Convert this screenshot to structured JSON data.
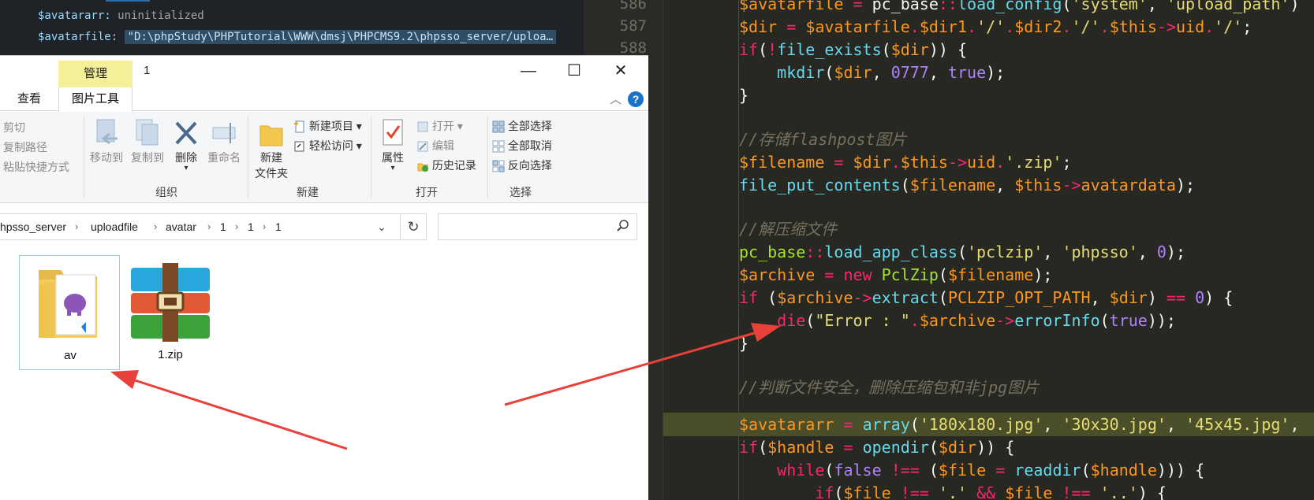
{
  "debugger": {
    "line1": {
      "name": "$avatararr:",
      "value": "uninitialized"
    },
    "line2": {
      "name": "$avatarfile:",
      "value": "\"D:\\phpStudy\\PHPTutorial\\WWW\\dmsj\\PHPCMS9.2\\phpsso_server/uploa…"
    }
  },
  "gutter": {
    "lines": [
      "586",
      "587",
      "588"
    ]
  },
  "code": {
    "comment_store": "//存储flashpost图片",
    "comment_unzip": "//解压缩文件",
    "comment_check": "//判断文件安全，删除压缩包和非jpg图片"
  },
  "explorer": {
    "title": "1",
    "context_tab": "管理",
    "tabs": {
      "view": "查看",
      "picture_tools": "图片工具"
    },
    "window_buttons": {
      "minimize": "—",
      "maximize": "☐",
      "close": "✕"
    },
    "help": "?",
    "ribbon": {
      "clipboard": {
        "cut": "剪切",
        "copy_path": "复制路径",
        "paste_shortcut": "粘贴快捷方式"
      },
      "organize": {
        "label": "组织",
        "move_to": "移动到",
        "copy_to": "复制到",
        "delete": "删除",
        "rename": "重命名"
      },
      "new": {
        "label": "新建",
        "new_folder_line1": "新建",
        "new_folder_line2": "文件夹",
        "new_item": "新建项目",
        "easy_access": "轻松访问"
      },
      "open": {
        "label": "打开",
        "properties": "属性",
        "open": "打开",
        "edit": "编辑",
        "history": "历史记录"
      },
      "select": {
        "label": "选择",
        "select_all": "全部选择",
        "select_none": "全部取消",
        "invert": "反向选择"
      }
    },
    "address": {
      "crumbs": [
        "hpsso_server",
        "uploadfile",
        "avatar",
        "1",
        "1",
        "1"
      ],
      "separator": "›"
    },
    "search": {
      "placeholder": ""
    },
    "files": [
      {
        "name": "av",
        "type": "folder"
      },
      {
        "name": "1.zip",
        "type": "winrar-archive"
      }
    ]
  },
  "colors": {
    "annotation_arrow": "#e8403a",
    "highlight_row": "#4a4f2a",
    "manage_tab": "#f4f09a"
  }
}
